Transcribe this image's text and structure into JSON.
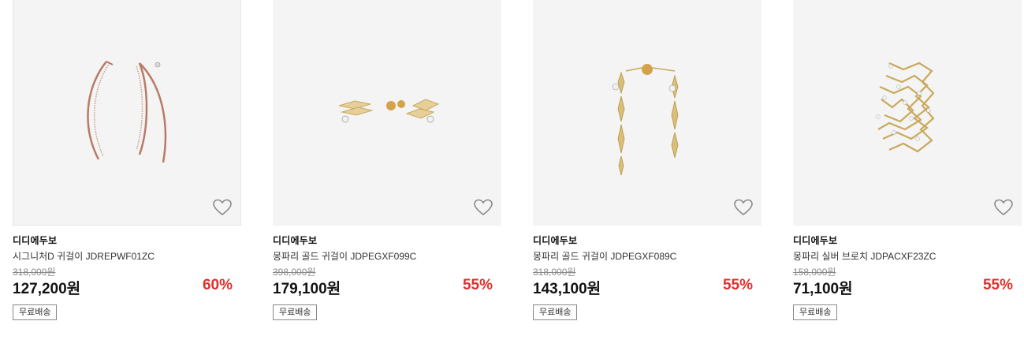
{
  "products": [
    {
      "brand": "디디에두보",
      "name": "시그니처D 귀걸이 JDREPWF01ZC",
      "original_price": "318,000원",
      "price": "127,200원",
      "discount": "60%",
      "badge": "무료배송",
      "wishlist_icon": "heart-outline-icon"
    },
    {
      "brand": "디디에두보",
      "name": "몽파리 골드 귀걸이 JDPEGXF099C",
      "original_price": "398,000원",
      "price": "179,100원",
      "discount": "55%",
      "badge": "무료배송",
      "wishlist_icon": "heart-outline-icon"
    },
    {
      "brand": "디디에두보",
      "name": "몽파리 골드 귀걸이 JDPEGXF089C",
      "original_price": "318,000원",
      "price": "143,100원",
      "discount": "55%",
      "badge": "무료배송",
      "wishlist_icon": "heart-outline-icon"
    },
    {
      "brand": "디디에두보",
      "name": "몽파리 실버 브로치 JDPACXF23ZC",
      "original_price": "158,000원",
      "price": "71,100원",
      "discount": "55%",
      "badge": "무료배송",
      "wishlist_icon": "heart-outline-icon"
    }
  ],
  "colors": {
    "discount": "#e0302c",
    "image_background": "#f4f4f4",
    "rose_gold": "#b97a66",
    "gold": "#c9a95c"
  }
}
